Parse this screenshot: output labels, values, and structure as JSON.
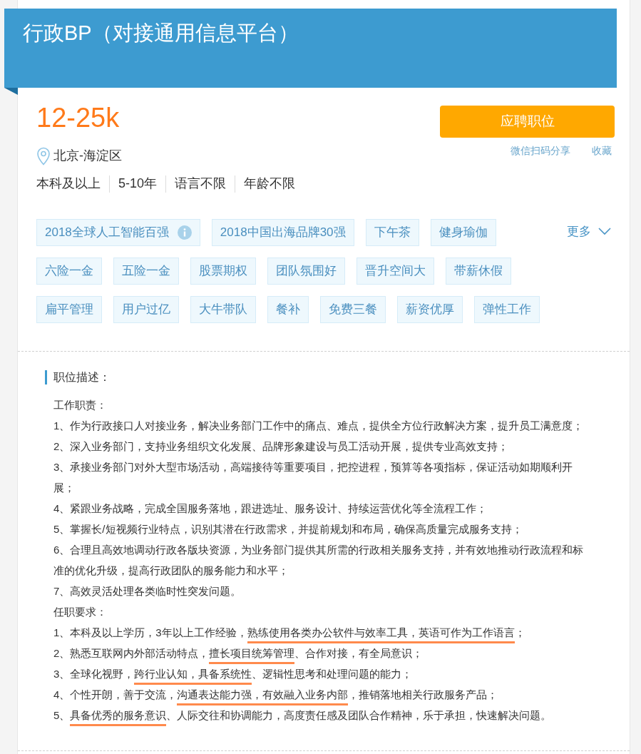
{
  "job": {
    "title": "行政BP（对接通用信息平台）",
    "salary": "12-25k",
    "location": "北京-海淀区",
    "requirements": [
      "本科及以上",
      "5-10年",
      "语言不限",
      "年龄不限"
    ],
    "apply_button": "应聘职位",
    "share_link": "微信扫码分享",
    "favorite_link": "收藏"
  },
  "tags": [
    {
      "label": "2018全球人工智能百强",
      "kind": "info"
    },
    {
      "label": "2018中国出海品牌30强",
      "kind": "plain"
    },
    {
      "label": "下午茶",
      "kind": "plain"
    },
    {
      "label": "健身瑜伽",
      "kind": "plain"
    },
    {
      "label": "六险一金",
      "kind": "plain"
    },
    {
      "label": "五险一金",
      "kind": "plain"
    },
    {
      "label": "股票期权",
      "kind": "plain"
    },
    {
      "label": "团队氛围好",
      "kind": "plain"
    },
    {
      "label": "晋升空间大",
      "kind": "plain"
    },
    {
      "label": "带薪休假",
      "kind": "plain"
    },
    {
      "label": "扁平管理",
      "kind": "plain"
    },
    {
      "label": "用户过亿",
      "kind": "plain"
    },
    {
      "label": "大牛带队",
      "kind": "plain"
    },
    {
      "label": "餐补",
      "kind": "plain"
    },
    {
      "label": "免费三餐",
      "kind": "plain"
    },
    {
      "label": "薪资优厚",
      "kind": "plain"
    },
    {
      "label": "弹性工作",
      "kind": "plain"
    }
  ],
  "more_link": "更多",
  "description": {
    "heading": "职位描述：",
    "lines": [
      {
        "segments": [
          {
            "text": "工作职责：",
            "underlined": false
          }
        ]
      },
      {
        "segments": [
          {
            "text": "1、作为行政接口人对接业务，解决业务部门工作中的痛点、难点，提供全方位行政解决方案，提升员工满意度；",
            "underlined": false
          }
        ]
      },
      {
        "segments": [
          {
            "text": "2、深入业务部门，支持业务组织文化发展、品牌形象建设与员工活动开展，提供专业高效支持；",
            "underlined": false
          }
        ]
      },
      {
        "segments": [
          {
            "text": "3、承接业务部门对外大型市场活动，高端接待等重要项目，把控进程，预算等各项指标，保证活动如期顺利开展；",
            "underlined": false
          }
        ]
      },
      {
        "segments": [
          {
            "text": "4、紧跟业务战略，完成全国服务落地，跟进选址、服务设计、持续运营优化等全流程工作；",
            "underlined": false
          }
        ]
      },
      {
        "segments": [
          {
            "text": "5、掌握长/短视频行业特点，识别其潜在行政需求，并提前规划和布局，确保高质量完成服务支持；",
            "underlined": false
          }
        ]
      },
      {
        "segments": [
          {
            "text": "6、合理且高效地调动行政各版块资源，为业务部门提供其所需的行政相关服务支持，并有效地推动行政流程和标准的优化升级，提高行政团队的服务能力和水平；",
            "underlined": false
          }
        ]
      },
      {
        "segments": [
          {
            "text": "7、高效灵活处理各类临时性突发问题。",
            "underlined": false
          }
        ]
      },
      {
        "segments": [
          {
            "text": "任职要求：",
            "underlined": false
          }
        ]
      },
      {
        "segments": [
          {
            "text": "1、本科及以上学历，3年以上工作经验，",
            "underlined": false
          },
          {
            "text": "熟练使用各类办公软件与效率工具，英语可作为工作语言",
            "underlined": true
          },
          {
            "text": "；",
            "underlined": false
          }
        ]
      },
      {
        "segments": [
          {
            "text": "2、熟悉互联网内外部活动特点，",
            "underlined": false
          },
          {
            "text": "擅长项目统筹管理",
            "underlined": true
          },
          {
            "text": "、合作对接，有全局意识；",
            "underlined": false
          }
        ]
      },
      {
        "segments": [
          {
            "text": "3、全球化视野，",
            "underlined": false
          },
          {
            "text": "跨行业认知，具备系统性",
            "underlined": true
          },
          {
            "text": "、逻辑性思考和处理问题的能力；",
            "underlined": false
          }
        ]
      },
      {
        "segments": [
          {
            "text": "4、个性开朗，善于交流，",
            "underlined": false
          },
          {
            "text": "沟通表达能力强，有效融入业务内部",
            "underlined": true
          },
          {
            "text": "，推销落地相关行政服务产品；",
            "underlined": false
          }
        ]
      },
      {
        "segments": [
          {
            "text": "5、",
            "underlined": false
          },
          {
            "text": "具备优秀的服务意识",
            "underlined": true
          },
          {
            "text": "、人际交往和协调能力，高度责任感及团队合作精神，乐于承担，快速解决问题。",
            "underlined": false
          }
        ]
      }
    ]
  }
}
